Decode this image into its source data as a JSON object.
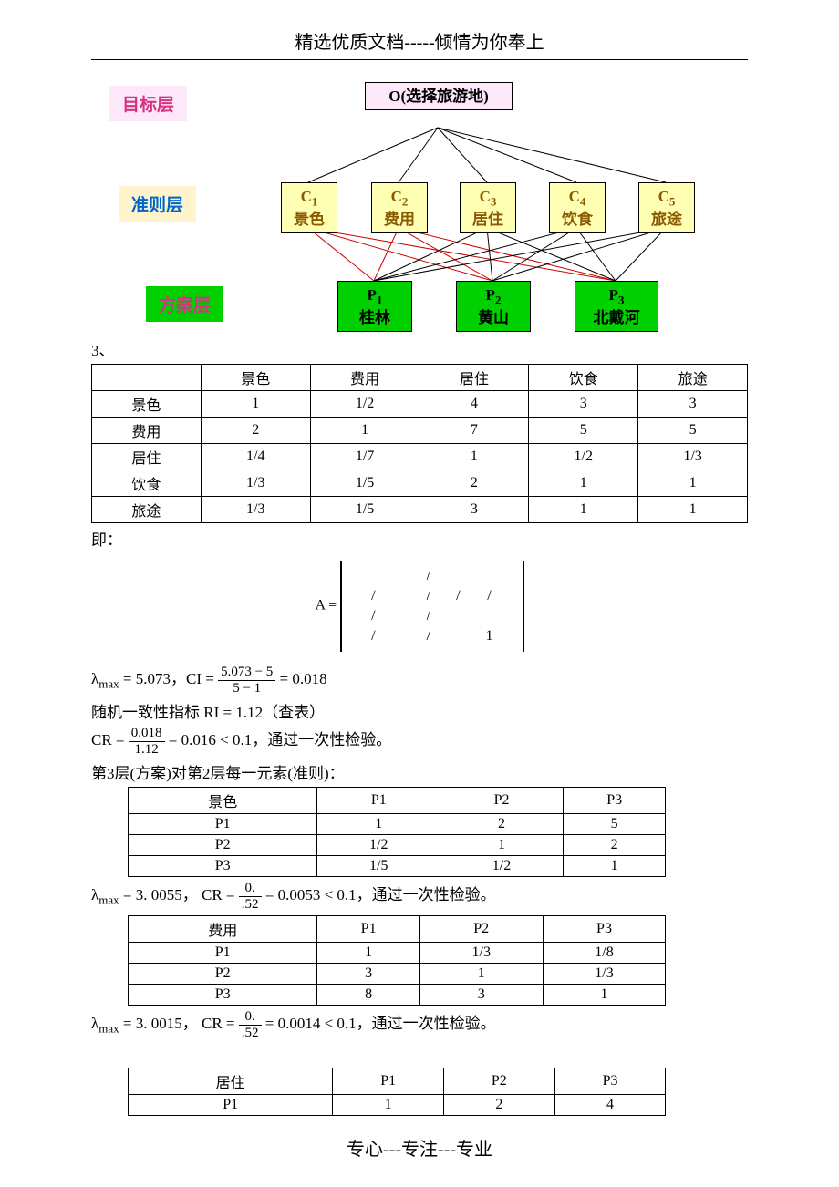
{
  "header": "精选优质文档-----倾情为你奉上",
  "footer": "专心---专注---专业",
  "diagram": {
    "layer_labels": {
      "goal": "目标层",
      "criteria": "准则层",
      "plan": "方案层"
    },
    "goal": {
      "sym": "O",
      "text": "(选择旅游地)"
    },
    "criteria": [
      {
        "sym": "C",
        "sub": "1",
        "text": "景色"
      },
      {
        "sym": "C",
        "sub": "2",
        "text": "费用"
      },
      {
        "sym": "C",
        "sub": "3",
        "text": "居住"
      },
      {
        "sym": "C",
        "sub": "4",
        "text": "饮食"
      },
      {
        "sym": "C",
        "sub": "5",
        "text": "旅途"
      }
    ],
    "plans": [
      {
        "sym": "P",
        "sub": "1",
        "text": "桂林"
      },
      {
        "sym": "P",
        "sub": "2",
        "text": "黄山"
      },
      {
        "sym": "P",
        "sub": "3",
        "text": "北戴河"
      }
    ]
  },
  "section_num": "3、",
  "table_criteria": {
    "headers": [
      "",
      "景色",
      "费用",
      "居住",
      "饮食",
      "旅途"
    ],
    "rows": [
      [
        "景色",
        "1",
        "1/2",
        "4",
        "3",
        "3"
      ],
      [
        "费用",
        "2",
        "1",
        "7",
        "5",
        "5"
      ],
      [
        "居住",
        "1/4",
        "1/7",
        "1",
        "1/2",
        "1/3"
      ],
      [
        "饮食",
        "1/3",
        "1/5",
        "2",
        "1",
        "1"
      ],
      [
        "旅途",
        "1/3",
        "1/5",
        "3",
        "1",
        "1"
      ]
    ]
  },
  "txt_ji": "即：",
  "matrix_label": "A =",
  "matrix": [
    [
      "",
      "",
      "/",
      "",
      ""
    ],
    [
      "/",
      "",
      "/",
      "/",
      "/"
    ],
    [
      "/",
      "",
      "/",
      "",
      ""
    ],
    [
      "/",
      "",
      "/",
      "",
      "1"
    ]
  ],
  "lambda1": "λ",
  "lambda1_sub": "max",
  "lambda1_eq": " = 5.073，CI = ",
  "frac1": {
    "num": "5.073 − 5",
    "den": "5 − 1"
  },
  "lambda1_res": " = 0.018",
  "ri_text": "随机一致性指标  RI = 1.12（查表）",
  "cr_prefix": "CR = ",
  "frac2": {
    "num": "0.018",
    "den": "1.12"
  },
  "cr_res": " = 0.016 < 0.1，通过一次性检验。",
  "layer3_text": "第3层(方案)对第2层每一元素(准则)：",
  "table_p1": {
    "headers": [
      "景色",
      "P1",
      "P2",
      "P3"
    ],
    "rows": [
      [
        "P1",
        "1",
        "2",
        "5"
      ],
      [
        "P2",
        "1/2",
        "1",
        "2"
      ],
      [
        "P3",
        "1/5",
        "1/2",
        "1"
      ]
    ]
  },
  "p1_lambda": "λ",
  "p1_sub": "max",
  "p1_eq": " = 3. 0055， CR = ",
  "p1_frac": {
    "num": "0.",
    "den": ".52"
  },
  "p1_res": " = 0.0053 < 0.1，通过一次性检验。",
  "table_p2": {
    "headers": [
      "费用",
      "P1",
      "P2",
      "P3"
    ],
    "rows": [
      [
        "P1",
        "1",
        "1/3",
        "1/8"
      ],
      [
        "P2",
        "3",
        "1",
        "1/3"
      ],
      [
        "P3",
        "8",
        "3",
        "1"
      ]
    ]
  },
  "p2_lambda": "λ",
  "p2_sub": "max",
  "p2_eq": " = 3. 0015， CR = ",
  "p2_frac": {
    "num": "0.",
    "den": ".52"
  },
  "p2_res": " = 0.0014 < 0.1，通过一次性检验。",
  "table_p3": {
    "headers": [
      "居住",
      "P1",
      "P2",
      "P3"
    ],
    "rows": [
      [
        "P1",
        "1",
        "2",
        "4"
      ]
    ]
  }
}
